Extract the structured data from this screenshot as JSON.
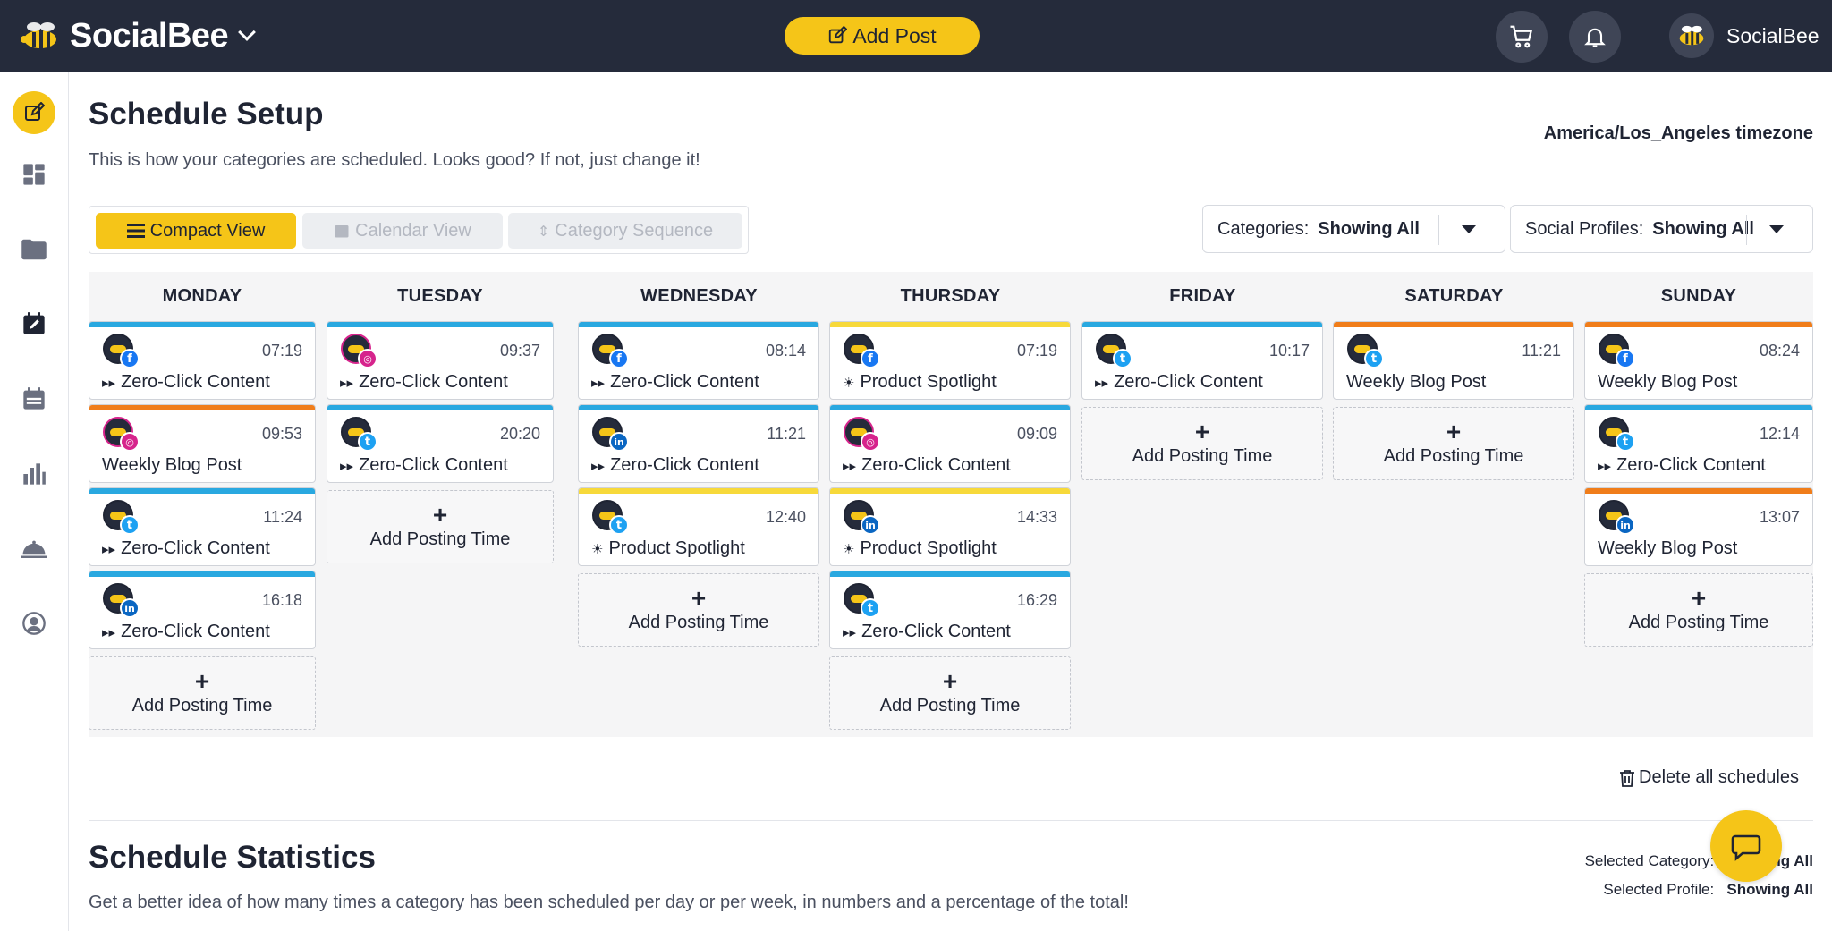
{
  "header": {
    "brand": "SocialBee",
    "add_post_label": "Add Post",
    "user_name": "SocialBee"
  },
  "page": {
    "title": "Schedule Setup",
    "subtitle": "This is how your categories are scheduled. Looks good? If not, just change it!",
    "timezone": "America/Los_Angeles timezone"
  },
  "views": {
    "compact": "Compact View",
    "calendar": "Calendar View",
    "sequence": "Category Sequence"
  },
  "filters": {
    "categories_label": "Categories:",
    "categories_value": "Showing All",
    "profiles_label": "Social Profiles:",
    "profiles_value": "Showing All"
  },
  "add_posting_time": "Add Posting Time",
  "colors": {
    "accent": "#f5c518",
    "header_bg": "#252b3b",
    "zero_click": "#29a8e0",
    "weekly_blog": "#f07d1a",
    "product_spotlight": "#f7d93a"
  },
  "days": [
    {
      "name": "MONDAY",
      "slots": [
        {
          "time": "07:19",
          "network": "fb",
          "category": "Zero-Click Content",
          "icon": "▸▸",
          "color": "#29a8e0"
        },
        {
          "time": "09:53",
          "network": "ig",
          "category": "Weekly Blog Post",
          "icon": "",
          "color": "#f07d1a"
        },
        {
          "time": "11:24",
          "network": "tw",
          "category": "Zero-Click Content",
          "icon": "▸▸",
          "color": "#29a8e0"
        },
        {
          "time": "16:18",
          "network": "li",
          "category": "Zero-Click Content",
          "icon": "▸▸",
          "color": "#29a8e0"
        }
      ]
    },
    {
      "name": "TUESDAY",
      "slots": [
        {
          "time": "09:37",
          "network": "ig",
          "category": "Zero-Click Content",
          "icon": "▸▸",
          "color": "#29a8e0"
        },
        {
          "time": "20:20",
          "network": "tw",
          "category": "Zero-Click Content",
          "icon": "▸▸",
          "color": "#29a8e0"
        }
      ]
    },
    {
      "name": "WEDNESDAY",
      "slots": [
        {
          "time": "08:14",
          "network": "fb",
          "category": "Zero-Click Content",
          "icon": "▸▸",
          "color": "#29a8e0"
        },
        {
          "time": "11:21",
          "network": "li",
          "category": "Zero-Click Content",
          "icon": "▸▸",
          "color": "#29a8e0"
        },
        {
          "time": "12:40",
          "network": "tw",
          "category": "Product Spotlight",
          "icon": "☀",
          "color": "#f7d93a"
        }
      ]
    },
    {
      "name": "THURSDAY",
      "slots": [
        {
          "time": "07:19",
          "network": "fb",
          "category": "Product Spotlight",
          "icon": "☀",
          "color": "#f7d93a"
        },
        {
          "time": "09:09",
          "network": "ig",
          "category": "Zero-Click Content",
          "icon": "▸▸",
          "color": "#29a8e0"
        },
        {
          "time": "14:33",
          "network": "li",
          "category": "Product Spotlight",
          "icon": "☀",
          "color": "#f7d93a"
        },
        {
          "time": "16:29",
          "network": "tw",
          "category": "Zero-Click Content",
          "icon": "▸▸",
          "color": "#29a8e0"
        }
      ]
    },
    {
      "name": "FRIDAY",
      "slots": [
        {
          "time": "10:17",
          "network": "tw",
          "category": "Zero-Click Content",
          "icon": "▸▸",
          "color": "#29a8e0"
        }
      ]
    },
    {
      "name": "SATURDAY",
      "slots": [
        {
          "time": "11:21",
          "network": "tw",
          "category": "Weekly Blog Post",
          "icon": "",
          "color": "#f07d1a"
        }
      ]
    },
    {
      "name": "SUNDAY",
      "slots": [
        {
          "time": "08:24",
          "network": "fb",
          "category": "Weekly Blog Post",
          "icon": "",
          "color": "#f07d1a"
        },
        {
          "time": "12:14",
          "network": "tw",
          "category": "Zero-Click Content",
          "icon": "▸▸",
          "color": "#29a8e0"
        },
        {
          "time": "13:07",
          "network": "li",
          "category": "Weekly Blog Post",
          "icon": "",
          "color": "#f07d1a"
        }
      ]
    }
  ],
  "delete_all_label": "Delete all schedules",
  "stats": {
    "title": "Schedule Statistics",
    "subtitle": "Get a better idea of how many times a category has been scheduled per day or per week, in numbers and a percentage of the total!",
    "selected_category_label": "Selected Category:",
    "selected_category_value": "Showing All",
    "selected_profile_label": "Selected Profile:",
    "selected_profile_value": "Showing All"
  }
}
